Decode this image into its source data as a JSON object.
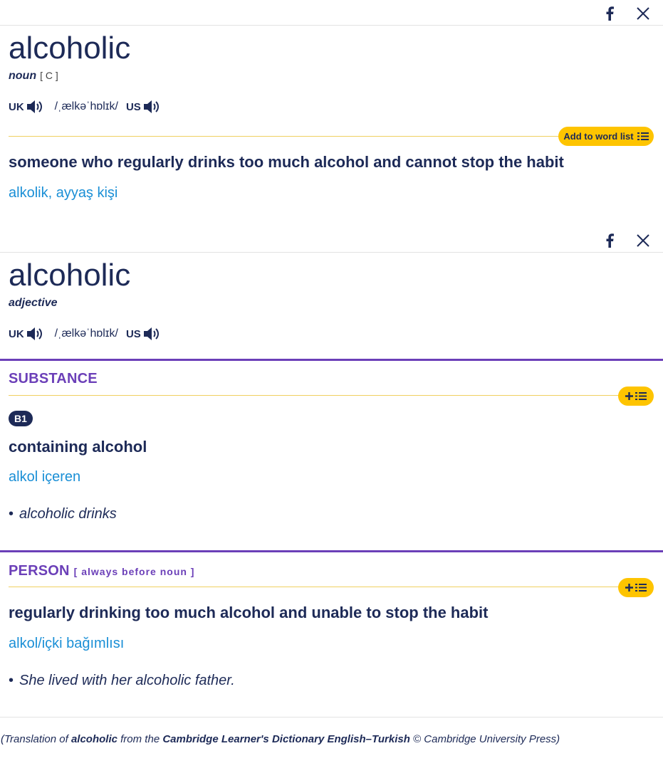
{
  "entries": [
    {
      "headword": "alcoholic",
      "pos": "noun",
      "grammar": "[ C ]",
      "uk_label": "UK",
      "us_label": "US",
      "ipa": "/ˌælkəˈhɒlɪk/",
      "add_to_word_list": "Add to word list",
      "definition": "someone who regularly drinks too much alcohol and cannot stop the habit",
      "translation": "alkolik, ayyaş kişi"
    },
    {
      "headword": "alcoholic",
      "pos": "adjective",
      "uk_label": "UK",
      "us_label": "US",
      "ipa": "/ˌælkəˈhɒlɪk/",
      "senses": [
        {
          "guideword": "SUBSTANCE",
          "level": "B1",
          "definition": "containing alcohol",
          "translation": "alkol içeren",
          "example": "alcoholic drinks"
        },
        {
          "guideword": "PERSON",
          "guideword_extra": "[ always before noun ]",
          "definition": "regularly drinking too much alcohol and unable to stop the habit",
          "translation": "alkol/içki bağımlısı",
          "example": "She lived with her alcoholic father."
        }
      ]
    }
  ],
  "citation": {
    "prefix": "(Translation of ",
    "word": "alcoholic",
    "middle": " from the ",
    "source": "Cambridge Learner's Dictionary English–Turkish",
    "suffix": " © Cambridge University Press)"
  },
  "icons": {
    "share_facebook": "facebook-icon",
    "share_x": "x-icon",
    "audio": "speaker-icon",
    "word_list": "list-icon",
    "add": "plus-icon"
  },
  "colors": {
    "navy": "#1d2a57",
    "link_blue": "#1a8fd6",
    "yellow": "#fec400",
    "purple": "#6b3fb8"
  }
}
